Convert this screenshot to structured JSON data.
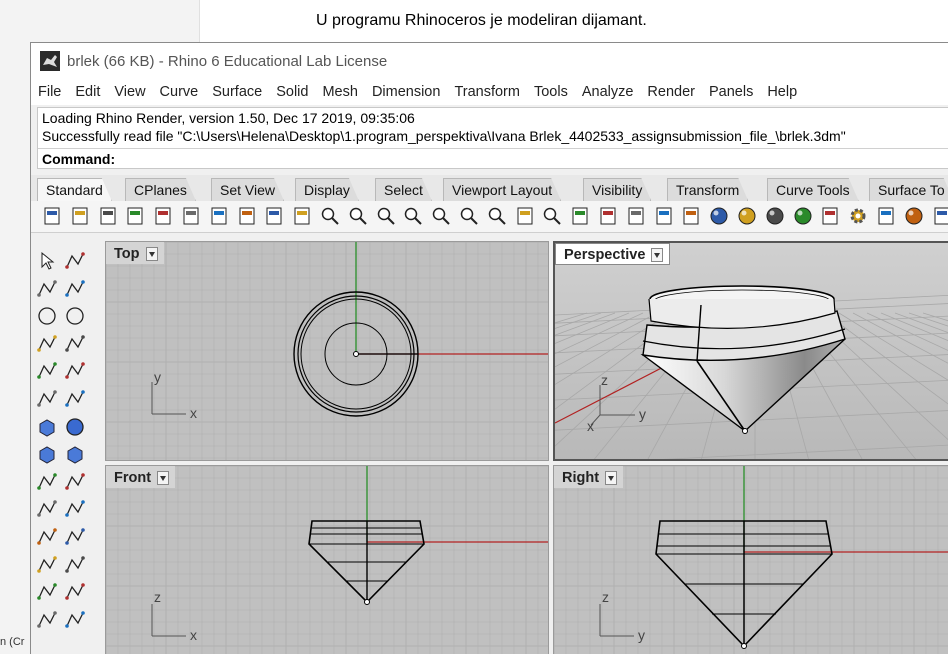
{
  "document": {
    "caption": "U programu Rhinoceros je modeliran dijamant.",
    "taskbar_stub": "n (Cr"
  },
  "window": {
    "title": "brlek (66 KB) - Rhino 6 Educational Lab License"
  },
  "menu": [
    "File",
    "Edit",
    "View",
    "Curve",
    "Surface",
    "Solid",
    "Mesh",
    "Dimension",
    "Transform",
    "Tools",
    "Analyze",
    "Render",
    "Panels",
    "Help"
  ],
  "command": {
    "history": [
      "Loading Rhino Render, version 1.50, Dec 17 2019, 09:35:06",
      "Successfully read file \"C:\\Users\\Helena\\Desktop\\1.program_perspektiva\\Ivana Brlek_4402533_assignsubmission_file_\\brlek.3dm\""
    ],
    "prompt": "Command:"
  },
  "tabs": [
    {
      "label": "Standard",
      "active": true
    },
    {
      "label": "CPlanes",
      "active": false
    },
    {
      "label": "Set View",
      "active": false
    },
    {
      "label": "Display",
      "active": false
    },
    {
      "label": "Select",
      "active": false
    },
    {
      "label": "Viewport Layout",
      "active": false
    },
    {
      "label": "Visibility",
      "active": false
    },
    {
      "label": "Transform",
      "active": false
    },
    {
      "label": "Curve Tools",
      "active": false
    },
    {
      "label": "Surface To",
      "active": false
    }
  ],
  "toolbar_icons": [
    "new-icon",
    "open-icon",
    "save-icon",
    "print-icon",
    "import-icon",
    "cut-icon",
    "copy-icon",
    "paste-icon",
    "undo-icon",
    "pan-icon",
    "rotate-view-icon",
    "zoom-dynamic-icon",
    "zoom-window-icon",
    "zoom-extents-icon",
    "zoom-selected-icon",
    "undo-view-icon",
    "viewport-layout-icon",
    "camera-icon",
    "named-view-icon",
    "construction-plane-icon",
    "object-snap-icon",
    "light-icon",
    "lock-icon",
    "layers-icon",
    "color-wheel-icon",
    "render-sphere-icon",
    "shaded-sphere-icon",
    "rendered-sphere-icon",
    "spotlight-icon",
    "options-gear-icon",
    "grasshopper-icon",
    "globe-icon",
    "help-icon"
  ],
  "left_tools": [
    "select-arrow-icon",
    "point-icon",
    "polyline-icon",
    "curve-points-icon",
    "circle-icon",
    "ellipse-icon",
    "arc-icon",
    "rectangle-icon",
    "polygon-icon",
    "fillet-curve-icon",
    "surface-corner-icon",
    "loft-icon",
    "box-icon",
    "sphere-icon",
    "cylinder-icon",
    "mesh-icon",
    "explode-icon",
    "split-icon",
    "trim-icon",
    "extend-icon",
    "boolean-union-icon",
    "array-icon",
    "move-icon",
    "rotate-icon",
    "text-icon",
    "dimension-icon",
    "group-icon",
    "extract-icon"
  ],
  "viewports": {
    "top": {
      "label": "Top",
      "axis_x": "x",
      "axis_y": "y"
    },
    "perspective": {
      "label": "Perspective",
      "axis_x": "x",
      "axis_y": "y",
      "axis_z": "z"
    },
    "front": {
      "label": "Front",
      "axis_x": "x",
      "axis_z": "z"
    },
    "right": {
      "label": "Right",
      "axis_y": "y",
      "axis_z": "z"
    }
  },
  "colors": {
    "viewport_bg": "#c0c0c0",
    "grid_line": "#b0b0b0",
    "axis_x": "#b22222",
    "axis_y": "#1e8c1e",
    "curve": "#000000"
  }
}
